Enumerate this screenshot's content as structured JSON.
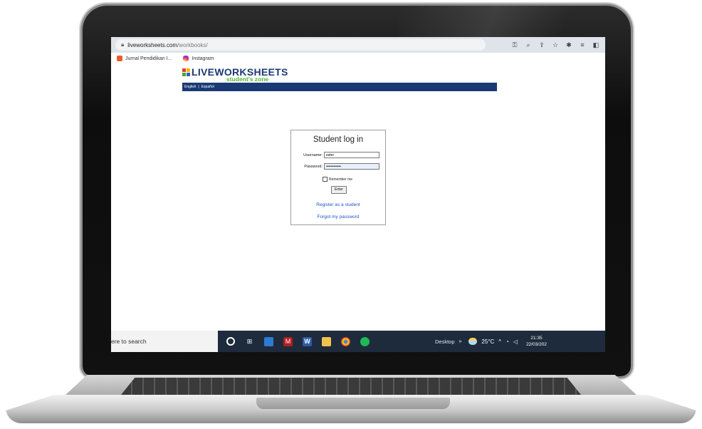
{
  "browser": {
    "url_domain": "liveworksheets.com",
    "url_path": "/workbooks/",
    "bookmarks": [
      {
        "label": "Jurnal Pendidikan I...",
        "icon": "jurnal-favicon"
      },
      {
        "label": "Instagram",
        "icon": "instagram-icon"
      }
    ],
    "toolbar_icons": [
      "key-icon",
      "zoom-icon",
      "share-icon",
      "star-icon",
      "extensions-icon",
      "reading-list-icon",
      "sidepanel-icon"
    ]
  },
  "site": {
    "logo_main": "LIVEWORKSHEETS",
    "logo_sub": "student's zone",
    "nav": [
      "English",
      "|",
      "Español"
    ],
    "colors": {
      "brand": "#1b3a73",
      "accent": "#5ab52e",
      "link": "#1a55c9"
    }
  },
  "login": {
    "title": "Student log in",
    "username_label": "Username:",
    "username_value": "ester",
    "password_label": "Password:",
    "password_value": "••••••••••••",
    "remember_label": "Remember me",
    "enter_label": "Enter",
    "register_link": "Register as a student",
    "forgot_link": "Forgot my password"
  },
  "taskbar": {
    "search_text": "ere to search",
    "desktop_label": "Desktop",
    "chevron": "»",
    "temperature": "25°C",
    "time": "21:35",
    "date": "22/03/202"
  }
}
